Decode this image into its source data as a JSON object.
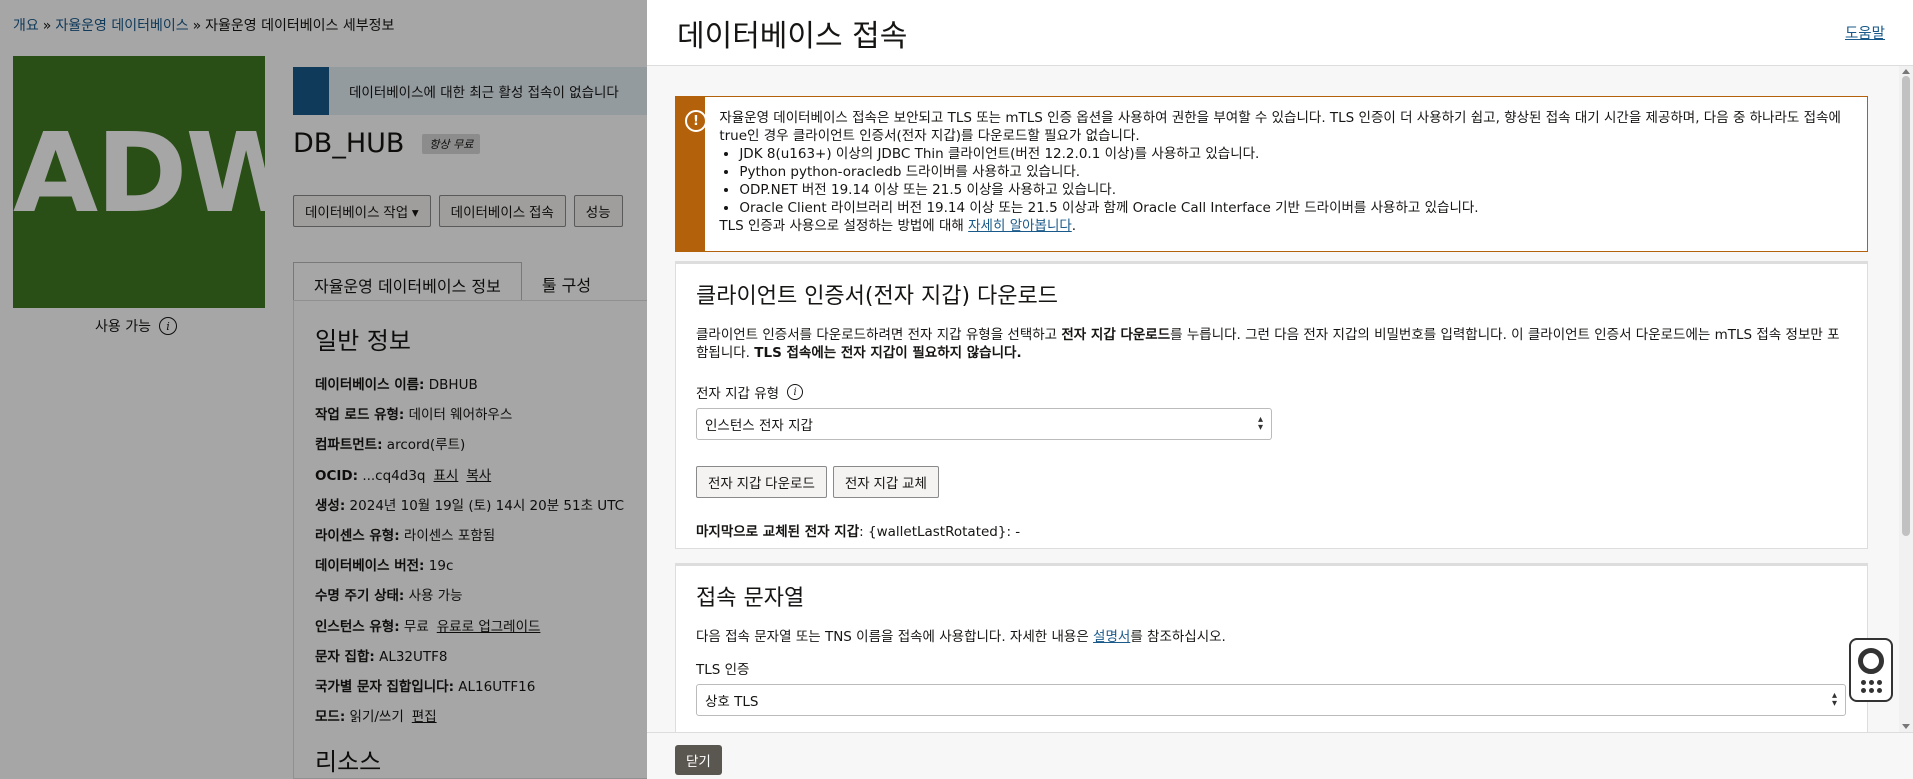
{
  "breadcrumb": [
    {
      "label": "개요",
      "link": true
    },
    {
      "label": "자율운영 데이터베이스",
      "link": true
    },
    {
      "label": "자율운영 데이터베이스 세부정보",
      "link": false
    }
  ],
  "logo": {
    "text": "ADW",
    "color": "#3f7a22"
  },
  "status": {
    "label": "사용 가능"
  },
  "banner": {
    "text": "데이터베이스에 대한 최근 활성 접속이 없습니다"
  },
  "db": {
    "name": "DB_HUB",
    "badge": "항상 무료"
  },
  "actions": {
    "more": "데이터베이스 작업",
    "connect": "데이터베이스 접속",
    "perf": "성능"
  },
  "tabs": {
    "info": "자율운영 데이터베이스 정보",
    "tools": "툴 구성"
  },
  "general": {
    "title": "일반 정보",
    "rows": [
      {
        "k": "데이터베이스 이름:",
        "v": "DBHUB"
      },
      {
        "k": "작업 로드 유형:",
        "v": "데이터 웨어하우스"
      },
      {
        "k": "컴파트먼트:",
        "v": "arcord(루트)"
      },
      {
        "k": "OCID:",
        "v": "...cq4d3q",
        "l1": "표시",
        "l2": "복사"
      },
      {
        "k": "생성:",
        "v": "2024년 10월 19일 (토) 14시 20분 51초 UTC"
      },
      {
        "k": "라이센스 유형:",
        "v": "라이센스 포함됨"
      },
      {
        "k": "데이터베이스 버전:",
        "v": "19c"
      },
      {
        "k": "수명 주기 상태:",
        "v": "사용 가능"
      },
      {
        "k": "인스턴스 유형:",
        "v": "무료",
        "l1": "유료로 업그레이드"
      },
      {
        "k": "문자 집합:",
        "v": "AL32UTF8"
      },
      {
        "k": "국가별 문자 집합입니다:",
        "v": "AL16UTF16"
      },
      {
        "k": "모드:",
        "v": "읽기/쓰기",
        "l1": "편집"
      }
    ],
    "resources": "리소스"
  },
  "drawer": {
    "title": "데이터베이스 접속",
    "help": "도움말",
    "warning": {
      "intro": "자율운영 데이터베이스 접속은 보안되고 TLS 또는 mTLS 인증 옵션을 사용하여 권한을 부여할 수 있습니다. TLS 인증이 더 사용하기 쉽고, 향상된 접속 대기 시간을 제공하며, 다음 중 하나라도 접속에 true인 경우 클라이언트 인증서(전자 지갑)를 다운로드할 필요가 없습니다.",
      "items": [
        "JDK 8(u163+) 이상의 JDBC Thin 클라이언트(버전 12.2.0.1 이상)를 사용하고 있습니다.",
        "Python python-oracledb 드라이버를 사용하고 있습니다.",
        "ODP.NET 버전 19.14 이상 또는 21.5 이상을 사용하고 있습니다.",
        "Oracle Client 라이브러리 버전 19.14 이상 또는 21.5 이상과 함께 Oracle Call Interface 기반 드라이버를 사용하고 있습니다."
      ],
      "outro": "TLS 인증과 사용으로 설정하는 방법에 대해",
      "link": "자세히 알아봅니다"
    },
    "wallet": {
      "title": "클라이언트 인증서(전자 지갑) 다운로드",
      "desc1": "클라이언트 인증서를 다운로드하려면 전자 지갑 유형을 선택하고 ",
      "desc_bold1": "전자 지갑 다운로드",
      "desc2": "를 누릅니다. 그런 다음 전자 지갑의 비밀번호를 입력합니다. 이 클라이언트 인증서 다운로드에는 mTLS 접속 정보만 포함됩니다. ",
      "desc_bold2": "TLS 접속에는 전자 지갑이 필요하지 않습니다.",
      "type_label": "전자 지갑 유형",
      "type_value": "인스턴스 전자 지갑",
      "download": "전자 지갑 다운로드",
      "rotate": "전자 지갑 교체",
      "last_label": "마지막으로 교체된 전자 지갑",
      "last_value": ": {walletLastRotated}:  -"
    },
    "conn": {
      "title": "접속 문자열",
      "desc1": "다음 접속 문자열 또는 TNS 이름을 접속에 사용합니다. 자세한 내용은 ",
      "link": "설명서",
      "desc2": "를 참조하십시오.",
      "tls_label": "TLS 인증",
      "tls_value": "상호 TLS"
    },
    "close": "닫기"
  }
}
